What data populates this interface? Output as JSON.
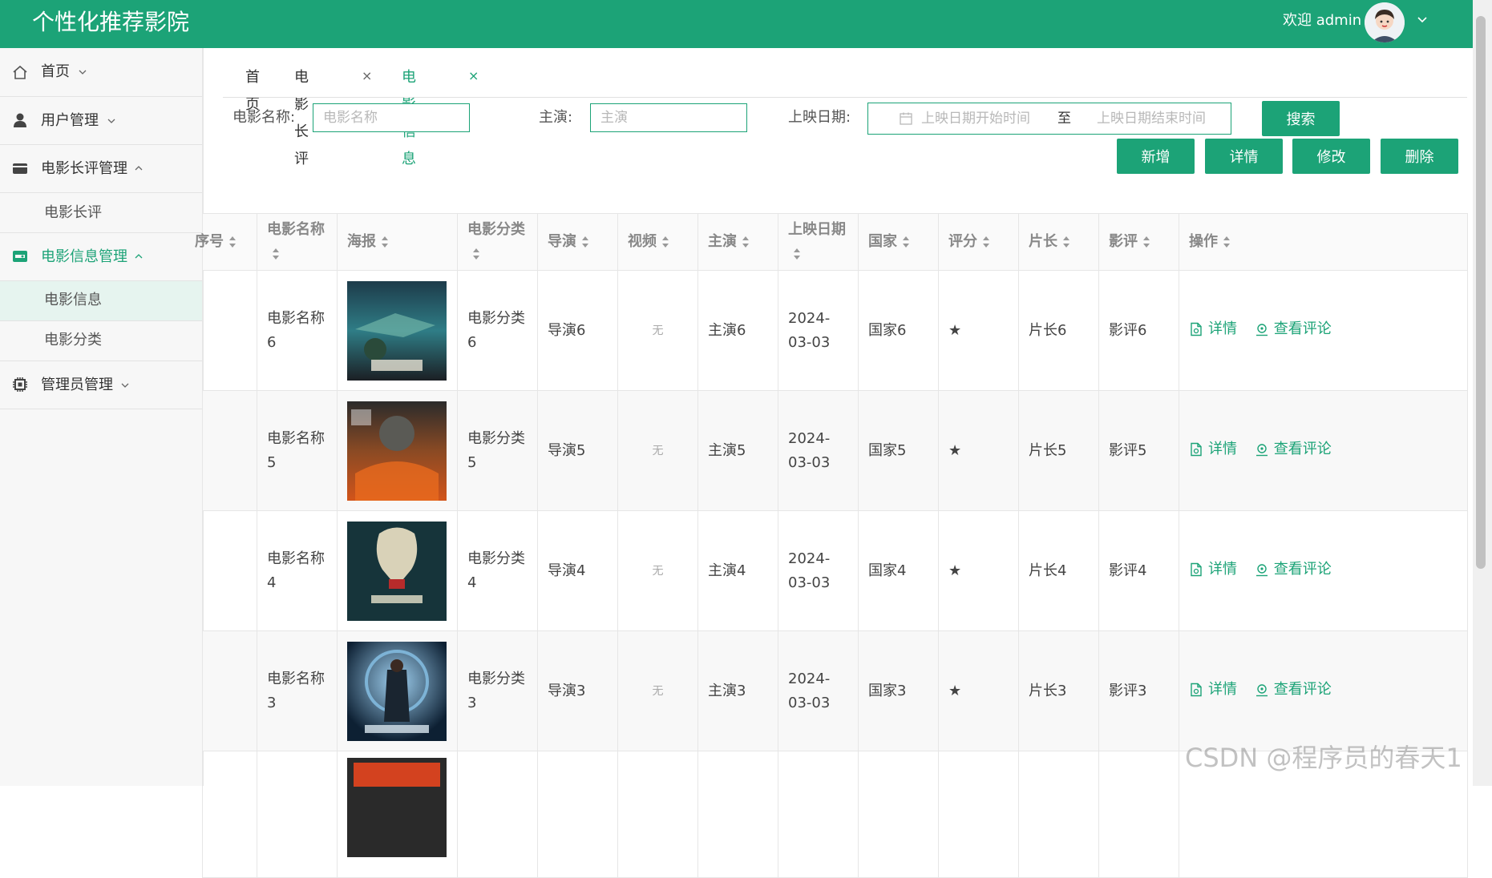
{
  "header": {
    "title": "个性化推荐影院",
    "welcome": "欢迎 admin",
    "brand_color": "#1ca377"
  },
  "sidebar": {
    "items": [
      {
        "label": "首页",
        "icon": "home-icon",
        "chevron": "down"
      },
      {
        "label": "用户管理",
        "icon": "user-icon",
        "chevron": "down"
      },
      {
        "label": "电影长评管理",
        "icon": "wallet-icon",
        "chevron": "up"
      },
      {
        "label": "电影信息管理",
        "icon": "film-icon",
        "chevron": "up"
      },
      {
        "label": "管理员管理",
        "icon": "chip-icon",
        "chevron": "down"
      }
    ],
    "sub": {
      "reviews": "电影长评",
      "movie_info": "电影信息",
      "movie_category": "电影分类"
    }
  },
  "tabs": [
    {
      "label": "首页",
      "closable": false
    },
    {
      "label": "电影长评",
      "closable": true
    },
    {
      "label": "电影信息",
      "closable": true,
      "active": true
    }
  ],
  "tab_close_glyph": "×",
  "filters": {
    "name_label": "电影名称:",
    "name_placeholder": "电影名称",
    "actor_label": "主演:",
    "actor_placeholder": "主演",
    "date_label": "上映日期:",
    "date_start_placeholder": "上映日期开始时间",
    "date_sep": "至",
    "date_end_placeholder": "上映日期结束时间"
  },
  "buttons": {
    "search": "搜索",
    "add": "新增",
    "detail": "详情",
    "edit": "修改",
    "delete": "删除"
  },
  "table": {
    "columns": [
      "序号",
      "电影名称",
      "海报",
      "电影分类",
      "导演",
      "视频",
      "主演",
      "上映日期",
      "国家",
      "评分",
      "片长",
      "影评",
      "操作"
    ],
    "rows": [
      {
        "name": "电影名称6",
        "category": "电影分类6",
        "director": "导演6",
        "video": "无",
        "actor": "主演6",
        "date": "2024-03-03",
        "country": "国家6",
        "rating": "★",
        "length": "片长6",
        "review": "影评6"
      },
      {
        "name": "电影名称5",
        "category": "电影分类5",
        "director": "导演5",
        "video": "无",
        "actor": "主演5",
        "date": "2024-03-03",
        "country": "国家5",
        "rating": "★",
        "length": "片长5",
        "review": "影评5"
      },
      {
        "name": "电影名称4",
        "category": "电影分类4",
        "director": "导演4",
        "video": "无",
        "actor": "主演4",
        "date": "2024-03-03",
        "country": "国家4",
        "rating": "★",
        "length": "片长4",
        "review": "影评4"
      },
      {
        "name": "电影名称3",
        "category": "电影分类3",
        "director": "导演3",
        "video": "无",
        "actor": "主演3",
        "date": "2024-03-03",
        "country": "国家3",
        "rating": "★",
        "length": "片长3",
        "review": "影评3"
      }
    ],
    "row_actions": {
      "detail": "详情",
      "comments": "查看评论"
    }
  },
  "watermark": "CSDN @程序员的春天1"
}
